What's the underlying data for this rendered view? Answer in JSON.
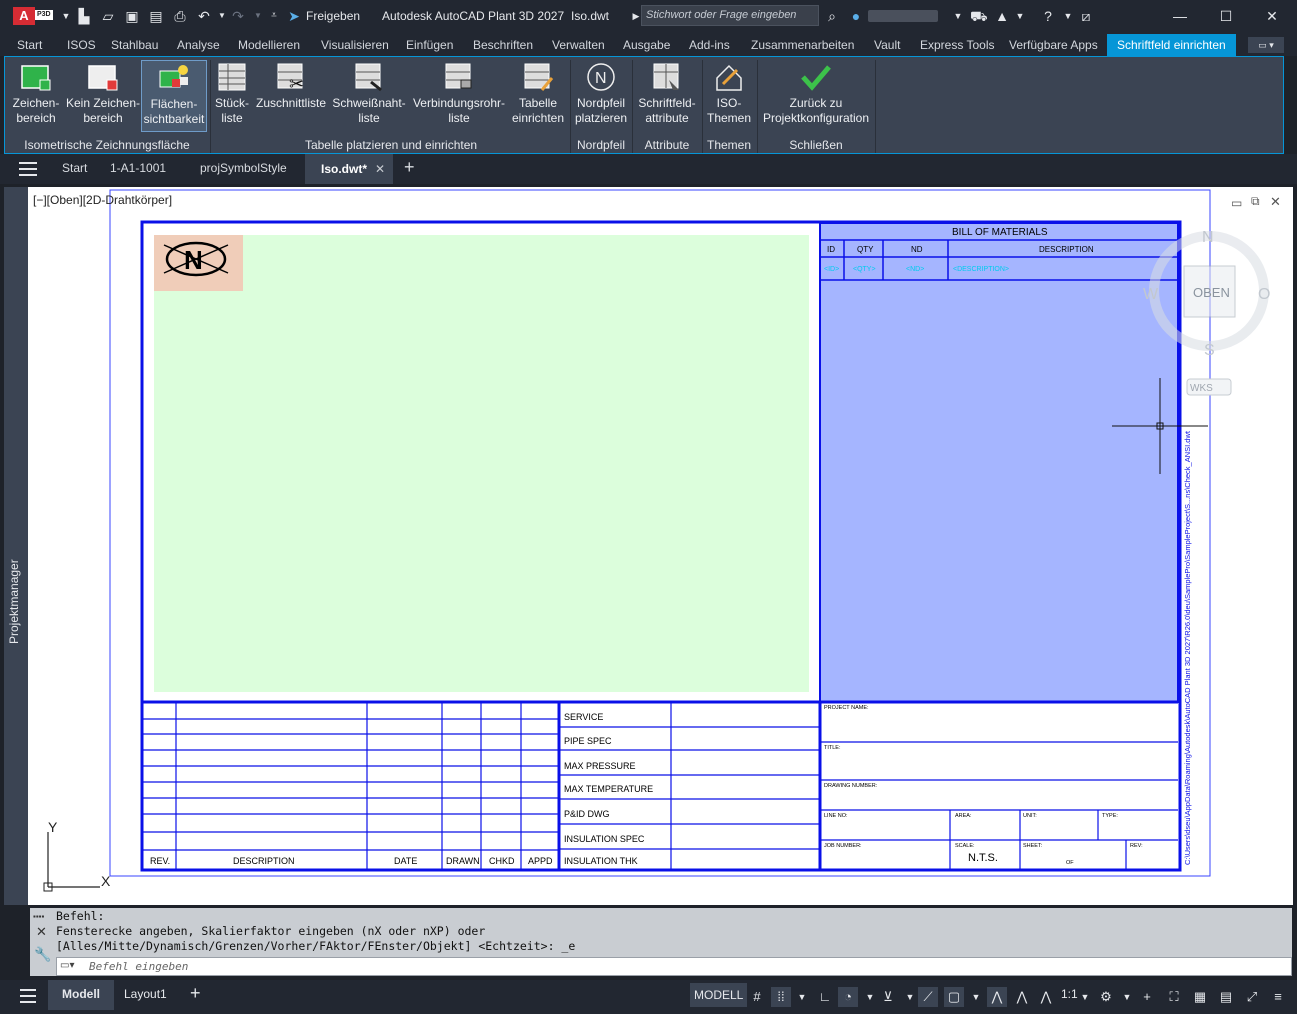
{
  "titlebar": {
    "app_badge": "A",
    "app_badge_sub": "P3D",
    "share_label": "Freigeben",
    "title": "Autodesk AutoCAD Plant 3D 2027",
    "filename": "Iso.dwt",
    "search_placeholder": "Stichwort oder Frage eingeben"
  },
  "menu": {
    "tabs": [
      "Start",
      "ISOS",
      "Stahlbau",
      "Analyse",
      "Modellieren",
      "Visualisieren",
      "Einfügen",
      "Beschriften",
      "Verwalten",
      "Ausgabe",
      "Add-ins",
      "Zusammenarbeiten",
      "Vault",
      "Express Tools",
      "Verfügbare Apps",
      "Schriftfeld einrichten"
    ],
    "active": "Schriftfeld einrichten"
  },
  "ribbon": {
    "buttons": [
      {
        "l1": "Zeichen-",
        "l2": "bereich"
      },
      {
        "l1": "Kein Zeichen-",
        "l2": "bereich"
      },
      {
        "l1": "Flächen-",
        "l2": "sichtbarkeit"
      },
      {
        "l1": "Stück-",
        "l2": "liste"
      },
      {
        "l1": "Zuschnittliste",
        "l2": ""
      },
      {
        "l1": "Schweißnaht-",
        "l2": "liste"
      },
      {
        "l1": "Verbindungsrohr-",
        "l2": "liste"
      },
      {
        "l1": "Tabelle",
        "l2": "einrichten"
      },
      {
        "l1": "Nordpfeil",
        "l2": "platzieren"
      },
      {
        "l1": "Schriftfeld-",
        "l2": "attribute"
      },
      {
        "l1": "ISO-",
        "l2": "Themen"
      },
      {
        "l1": "Zurück zu",
        "l2": "Projektkonfiguration"
      }
    ],
    "groups": [
      "Isometrische Zeichnungsfläche",
      "Tabelle platzieren und einrichten",
      "Nordpfeil",
      "Attribute",
      "Themen",
      "Schließen"
    ]
  },
  "filetabs": {
    "start": "Start",
    "tabs": [
      "1-A1-1001",
      "projSymbolStyle",
      "Iso.dwt*"
    ]
  },
  "sidebar": {
    "label": "Projektmanager"
  },
  "viewport": {
    "label": "[−][Oben][2D-Drahtkörper]"
  },
  "viewcube": {
    "n": "N",
    "s": "S",
    "w": "W",
    "o": "O",
    "face": "OBEN",
    "wcs": "WKS"
  },
  "drawing": {
    "north_symbol": "N",
    "bom_title": "BILL  OF  MATERIALS",
    "bom_headers": [
      "ID",
      "QTY",
      "ND",
      "DESCRIPTION"
    ],
    "bom_fields": [
      "<ID>",
      "<QTY>",
      "<ND>",
      "<DESCRIPTION>"
    ],
    "rev_headers": [
      "REV.",
      "DESCRIPTION",
      "DATE",
      "DRAWN",
      "CHKD",
      "APPD"
    ],
    "spec_labels": [
      "SERVICE",
      "PIPE  SPEC",
      "MAX  PRESSURE",
      "MAX  TEMPERATURE",
      "P&ID  DWG",
      "INSULATION  SPEC",
      "INSULATION  THK"
    ],
    "title_labels": {
      "project_name": "PROJECT NAME:",
      "title": "TITLE:",
      "drawing_number": "DRAWING NUMBER:",
      "line_no": "LINE NO:",
      "area": "AREA:",
      "unit": "UNIT:",
      "type": "TYPE:",
      "job_number": "JOB NUMBER:",
      "scale": "SCALE:",
      "scale_value": "N.T.S.",
      "sheet": "SHEET:",
      "sheet_of": "OF",
      "rev": "REV:"
    },
    "path_text": "C:\\Users\\dseu\\AppData\\Roaming\\Autodesk\\AutoCAD Plant 3D 2027\\R26.0\\deu\\SamplePro\\SampleProject\\S...ns\\Check_ANSI.dwt",
    "axis_x": "X",
    "axis_y": "Y"
  },
  "command": {
    "line1": "Befehl:",
    "line2": "Fensterecke angeben, Skalierfaktor eingeben (nX oder nXP) oder",
    "line3": "[Alles/Mitte/Dynamisch/Grenzen/Vorher/FAktor/FEnster/Objekt] <Echtzeit>: _e",
    "placeholder": "Befehl eingeben"
  },
  "status": {
    "layout_tabs": [
      "Modell",
      "Layout1"
    ],
    "model_label": "MODELL",
    "scale": "1:1"
  },
  "colors": {
    "accent": "#0696d7",
    "drawing_blue": "#0a10e8",
    "viewport_green": "#dcfedc",
    "bom_fill": "#a5b5ff",
    "north_fill": "#f0cdb9"
  }
}
